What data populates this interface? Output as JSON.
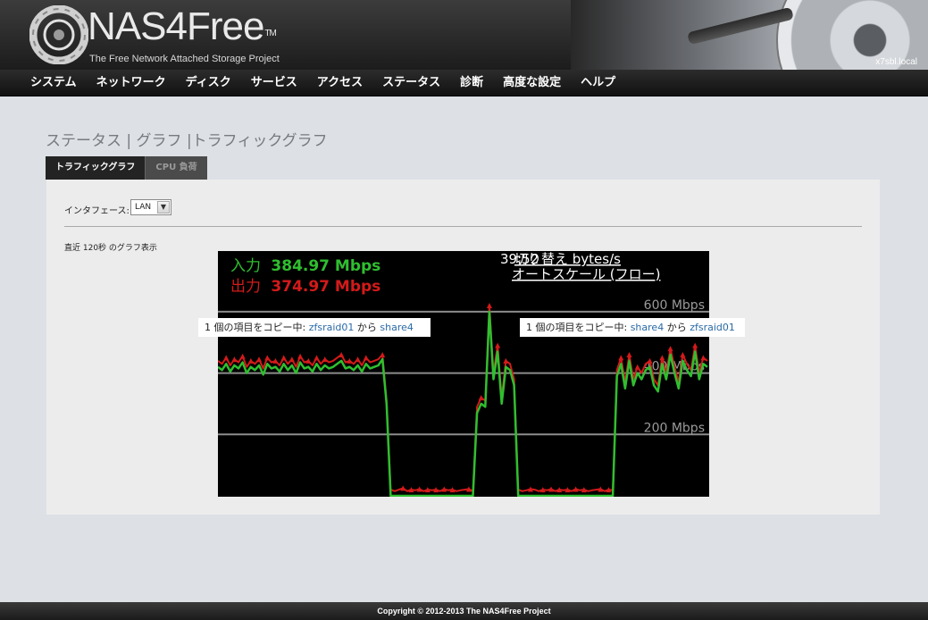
{
  "header": {
    "logo_text": "NAS4Free",
    "logo_tm": "TM",
    "tagline": "The Free Network Attached Storage Project",
    "hostname": "x7sbl.local"
  },
  "nav": {
    "items": [
      "システム",
      "ネットワーク",
      "ディスク",
      "サービス",
      "アクセス",
      "ステータス",
      "診断",
      "高度な設定",
      "ヘルプ"
    ]
  },
  "page": {
    "title": "ステータス | グラフ |トラフィックグラフ",
    "tabs": [
      {
        "label": "トラフィックグラフ",
        "active": true
      },
      {
        "label": "CPU 負荷",
        "active": false
      }
    ],
    "interface_label": "インタフェース:",
    "interface_value": "LAN",
    "graph_caption": "直近 120秒 のグラフ表示"
  },
  "graph": {
    "in_label": "入力",
    "in_value": "384.97 Mbps",
    "out_label": "出力",
    "out_value": "374.97 Mbps",
    "top_text_overlap": "39:52",
    "switch_text": "切り替え bytes/s",
    "scale_text": "オートスケール (フロー)",
    "grid_labels": [
      "600 Mbps",
      "400 Mbps",
      "200 Mbps"
    ],
    "colors": {
      "in": "#2fbf2f",
      "out": "#d41a1a",
      "grid": "#8c8c8c"
    },
    "notice_left": {
      "prefix": "1 個の項目をコピー中: ",
      "src": "zfsraid01",
      "mid": " から ",
      "dst": "share4"
    },
    "notice_right": {
      "prefix": "1 個の項目をコピー中: ",
      "src": "share4",
      "mid": " から ",
      "dst": "zfsraid01"
    }
  },
  "chart_data": {
    "type": "line",
    "ylim": [
      0,
      800
    ],
    "grid_values": [
      600,
      400,
      200
    ],
    "series": [
      {
        "name": "入力",
        "values": [
          420,
          410,
          430,
          405,
          425,
          415,
          435,
          400,
          420,
          410,
          425,
          395,
          430,
          415,
          420,
          405,
          430,
          410,
          425,
          400,
          435,
          415,
          420,
          405,
          430,
          410,
          425,
          415,
          420,
          430,
          440,
          415,
          420,
          410,
          425,
          405,
          430,
          415,
          420,
          425,
          445,
          300,
          0,
          0,
          0,
          0,
          0,
          0,
          0,
          0,
          0,
          0,
          0,
          0,
          0,
          0,
          0,
          0,
          0,
          0,
          0,
          0,
          0,
          270,
          300,
          290,
          600,
          380,
          470,
          300,
          420,
          410,
          360,
          0,
          0,
          0,
          0,
          0,
          0,
          0,
          0,
          0,
          0,
          0,
          0,
          0,
          0,
          0,
          0,
          0,
          0,
          0,
          0,
          0,
          0,
          0,
          0,
          390,
          430,
          350,
          440,
          360,
          400,
          380,
          410,
          420,
          360,
          340,
          430,
          380,
          460,
          400,
          350,
          440,
          410,
          390,
          470,
          380,
          430,
          420
        ]
      },
      {
        "name": "出力",
        "values": [
          440,
          430,
          450,
          425,
          445,
          435,
          455,
          420,
          440,
          430,
          445,
          415,
          450,
          435,
          440,
          425,
          450,
          430,
          445,
          420,
          455,
          435,
          440,
          425,
          450,
          430,
          445,
          435,
          440,
          450,
          460,
          435,
          440,
          430,
          445,
          425,
          450,
          435,
          440,
          445,
          460,
          310,
          20,
          15,
          20,
          25,
          15,
          20,
          18,
          22,
          15,
          20,
          18,
          20,
          15,
          22,
          18,
          20,
          15,
          18,
          20,
          22,
          15,
          290,
          320,
          310,
          620,
          400,
          490,
          320,
          440,
          430,
          380,
          20,
          15,
          18,
          22,
          20,
          15,
          20,
          18,
          22,
          15,
          20,
          18,
          20,
          15,
          22,
          18,
          20,
          15,
          18,
          20,
          22,
          15,
          20,
          18,
          410,
          450,
          370,
          460,
          380,
          420,
          400,
          430,
          440,
          380,
          360,
          450,
          400,
          480,
          420,
          370,
          460,
          430,
          410,
          490,
          400,
          450,
          440
        ]
      }
    ]
  },
  "footer": {
    "text": "Copyright © 2012-2013 The NAS4Free Project"
  }
}
